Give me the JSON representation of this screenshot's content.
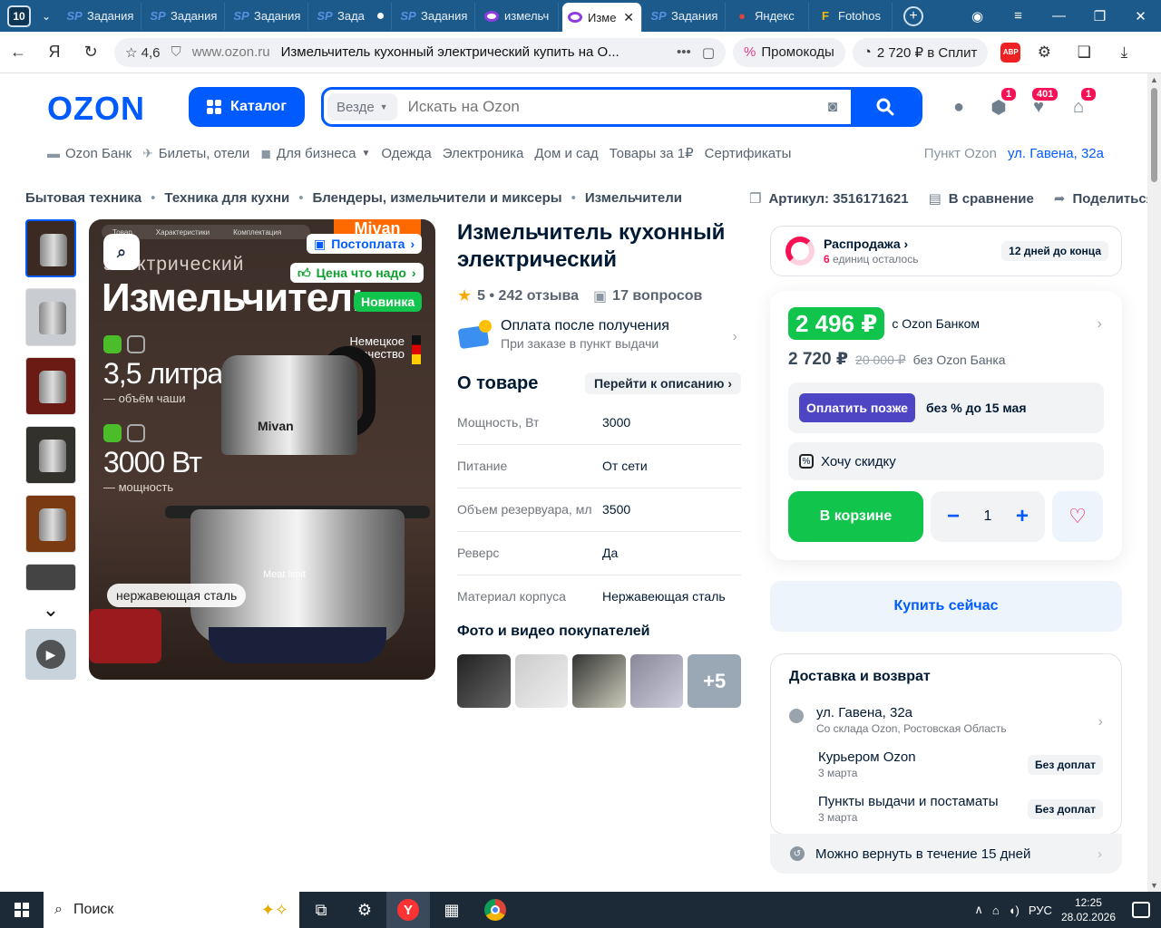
{
  "browser": {
    "tab_count": "10",
    "tabs": [
      {
        "title": "Задания",
        "icon": "sp"
      },
      {
        "title": "Задания",
        "icon": "sp"
      },
      {
        "title": "Задания",
        "icon": "sp"
      },
      {
        "title": "Зада",
        "icon": "sp"
      },
      {
        "title": "Задания",
        "icon": "sp"
      },
      {
        "title": "измельч",
        "icon": "ozon"
      },
      {
        "title": "Изме",
        "icon": "ozon"
      },
      {
        "title": "Задания",
        "icon": "sp"
      },
      {
        "title": "Яндекс",
        "icon": "map"
      },
      {
        "title": "Fotohos",
        "icon": "f"
      }
    ],
    "rating": "4,6",
    "host": "www.ozon.ru",
    "page_title": "Измельчитель кухонный электрический купить на O...",
    "promo": "Промокоды",
    "split": "2 720 ₽ в Сплит",
    "abp": "ABP"
  },
  "header": {
    "logo": "OZON",
    "catalog": "Каталог",
    "scope": "Везде",
    "search_placeholder": "Искать на Ozon",
    "badges": {
      "orders": "1",
      "favorites": "401",
      "cart": "1"
    }
  },
  "subnav": {
    "items": [
      "Ozon Банк",
      "Билеты, отели",
      "Для бизнеса",
      "Одежда",
      "Электроника",
      "Дом и сад",
      "Товары за 1₽",
      "Сертификаты"
    ],
    "pickup_label": "Пункт Ozon",
    "pickup_address": "ул. Гавена, 32а"
  },
  "breadcrumbs": [
    "Бытовая техника",
    "Техника для кухни",
    "Блендеры, измельчители и миксеры",
    "Измельчители"
  ],
  "crumb_actions": {
    "article": "Артикул: 3516171621",
    "compare": "В сравнение",
    "share": "Поделиться"
  },
  "photo": {
    "tabs": [
      "Товар",
      "Характеристики",
      "Комплектация"
    ],
    "brand": "Mivan",
    "tag_installment": "Постоплата",
    "tag_choice": "Цена что надо",
    "tag_new": "Новинка",
    "subtitle": "электрический",
    "title": "Измельчитель",
    "volume": "3,5 литра",
    "volume_caption": "— объём чаши",
    "power": "3000 Вт",
    "power_caption": "— мощность",
    "germany": "Немецкое качество",
    "logo_on_device": "Mivan",
    "steel": "нержавеющая сталь",
    "meat_label": "Meat limit"
  },
  "product": {
    "title": "Измельчитель кухонный электрический",
    "rating": "5",
    "reviews": "242 отзыва",
    "questions": "17 вопросов",
    "pay_after": "Оплата после получения",
    "pay_after_sub": "При заказе в пункт выдачи",
    "about": "О товаре",
    "goto_desc": "Перейти к описанию",
    "specs": [
      {
        "k": "Мощность, Вт",
        "v": "3000"
      },
      {
        "k": "Питание",
        "v": "От сети"
      },
      {
        "k": "Объем резервуара, мл",
        "v": "3500"
      },
      {
        "k": "Реверс",
        "v": "Да"
      },
      {
        "k": "Материал корпуса",
        "v": "Нержавеющая сталь"
      }
    ],
    "ugc_title": "Фото и видео покупателей",
    "ugc_more": "+5"
  },
  "side": {
    "sale": "Распродажа",
    "sale_count": "6",
    "sale_left": "единиц осталось",
    "sale_days": "12 дней до конца",
    "price_card": "2 496 ₽",
    "price_card_label": "с Ozon Банком",
    "price": "2 720 ₽",
    "price_old": "20 000 ₽",
    "price_no_card": "без Ozon Банка",
    "paylater_btn": "Оплатить позже",
    "paylater_text": "без % до 15 мая",
    "want_discount": "Хочу скидку",
    "in_cart": "В корзине",
    "qty": "1",
    "buy_now": "Купить сейчас",
    "delivery_title": "Доставка и возврат",
    "address": "ул. Гавена, 32а",
    "warehouse": "Со склада Ozon, Ростовская Область",
    "options": [
      {
        "name": "Курьером Ozon",
        "date": "3 марта",
        "tag": "Без доплат"
      },
      {
        "name": "Пункты выдачи и постаматы",
        "date": "3 марта",
        "tag": "Без доплат"
      }
    ],
    "return": "Можно вернуть в течение 15 дней"
  },
  "taskbar": {
    "search": "Поиск",
    "lang": "РУС",
    "time": "12:25",
    "date": "28.02.2026"
  }
}
